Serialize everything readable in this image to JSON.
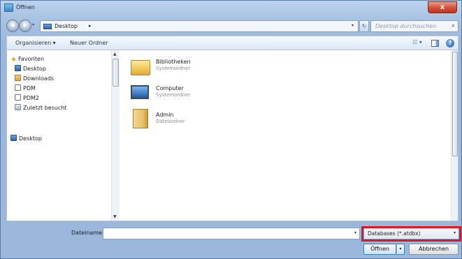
{
  "window": {
    "title": "Öffnen",
    "close_symbol": "x"
  },
  "address": {
    "location": "Desktop",
    "separator": "▸",
    "search_placeholder": "Desktop durchsuchen"
  },
  "toolbar": {
    "organize_label": "Organisieren ▾",
    "new_folder_label": "Neuer Ordner"
  },
  "sidebar": {
    "items": [
      {
        "label": "Favoriten",
        "icon": "star-icon"
      },
      {
        "label": "Desktop",
        "icon": "desktop-icon"
      },
      {
        "label": "Downloads",
        "icon": "downloads-folder-icon"
      },
      {
        "label": "PDM",
        "icon": "network-drive-icon"
      },
      {
        "label": "PDM2",
        "icon": "network-drive-icon"
      },
      {
        "label": "Zuletzt besucht",
        "icon": "recent-places-icon"
      }
    ],
    "desktop_root": {
      "label": "Desktop",
      "icon": "desktop-icon"
    }
  },
  "files": [
    {
      "name": "Bibliotheken",
      "type": "Systemordner",
      "icon": "libraries-icon"
    },
    {
      "name": "Computer",
      "type": "Systemordner",
      "icon": "computer-icon"
    },
    {
      "name": "Admin",
      "type": "Dateiordner",
      "icon": "folder-icon"
    }
  ],
  "bottom": {
    "filename_label": "Dateiname:",
    "filename_value": "",
    "filetype_selected": "Databases (*.atdbx)",
    "open_label": "Öffnen",
    "cancel_label": "Abbrechen"
  },
  "colors": {
    "highlight": "#e8141b",
    "titlebar": "#a9c3e3",
    "close_button": "#c0331c"
  }
}
